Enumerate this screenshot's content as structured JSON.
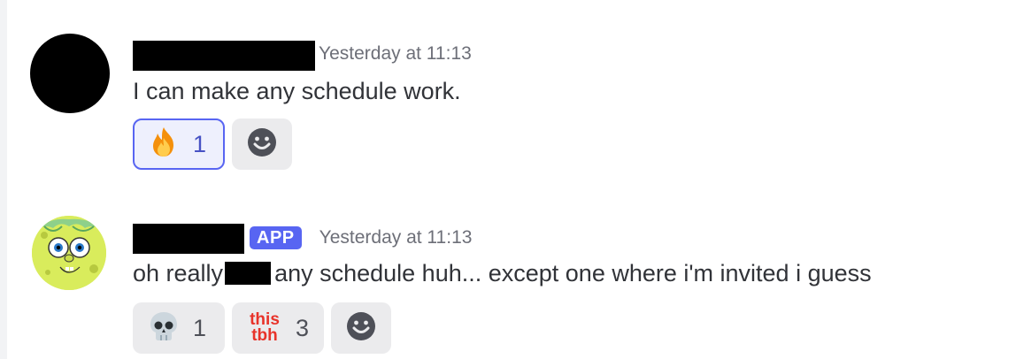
{
  "messages": [
    {
      "timestamp": "Yesterday at 11:13",
      "content": "I can make any schedule work.",
      "reactions": [
        {
          "emoji": "fire-emoji",
          "count": "1",
          "active": true
        }
      ],
      "add_reaction_icon": "smiley-add-icon"
    },
    {
      "badge": "APP",
      "timestamp": "Yesterday at 11:13",
      "content_before": "oh really",
      "content_after": "any schedule huh... except one where i'm invited i guess",
      "reactions": [
        {
          "emoji": "skull-emoji",
          "count": "1",
          "active": false
        },
        {
          "emoji": "this-tbh-emoji",
          "label_top": "this",
          "label_bottom": "tbh",
          "count": "3",
          "active": false
        }
      ],
      "add_reaction_icon": "smiley-add-icon"
    }
  ],
  "colors": {
    "accent": "#5865f2",
    "text": "#313338",
    "muted": "#6d6f78",
    "pill": "#ebebed"
  }
}
